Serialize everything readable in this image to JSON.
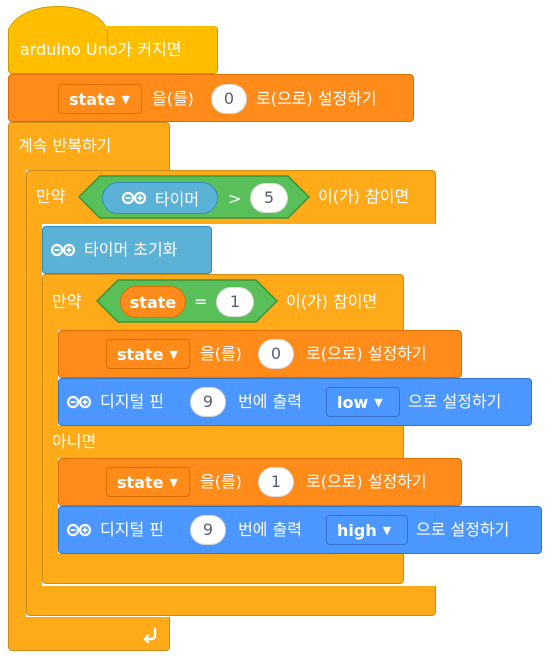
{
  "hat": {
    "label": "arduino Uno가 커지면"
  },
  "set_initial": {
    "variable": "state",
    "assign_label": "을(를)",
    "value": "0",
    "suffix": "로(으로) 설정하기"
  },
  "forever": {
    "label": "계속 반복하기"
  },
  "outer_if": {
    "if_label": "만약",
    "timer_label": "타이머",
    "operator": ">",
    "compare_value": "5",
    "then_label": "이(가) 참이면"
  },
  "reset_timer": {
    "label": "타이머 초기화"
  },
  "inner_if": {
    "if_label": "만약",
    "variable": "state",
    "operator": "=",
    "compare_value": "1",
    "then_label": "이(가) 참이면"
  },
  "then_branch": {
    "set_variable": "state",
    "assign_label": "을(를)",
    "value": "0",
    "suffix": "로(으로) 설정하기",
    "digital_label": "디지털 핀",
    "pin": "9",
    "output_label": "번에 출력",
    "level": "low",
    "output_suffix": "으로 설정하기"
  },
  "else_label": "아니면",
  "else_branch": {
    "set_variable": "state",
    "assign_label": "을(를)",
    "value": "1",
    "suffix": "로(으로) 설정하기",
    "digital_label": "디지털 핀",
    "pin": "9",
    "output_label": "번에 출력",
    "level": "high",
    "output_suffix": "으로 설정하기"
  },
  "icons": {
    "arduino": "arduino-infinity-icon",
    "loop_arrow": "loop-arrow-icon",
    "dropdown": "dropdown-caret-icon"
  },
  "colors": {
    "event": "#FFBF00",
    "control": "#FFAB19",
    "variable": "#FF8C1A",
    "arduino": "#4C97FF",
    "timer": "#5CB1D6",
    "operator": "#59C059"
  }
}
